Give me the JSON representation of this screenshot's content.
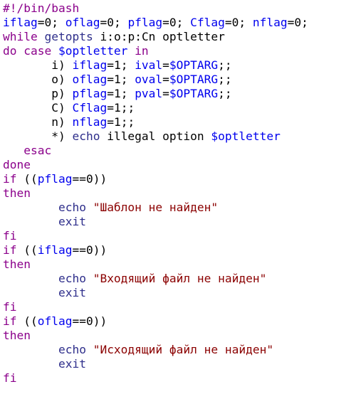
{
  "colors": {
    "default": "#000000",
    "keyword": "#8b008b",
    "variable": "#0000ee",
    "string": "#8b0000",
    "builtin": "#2e2e8b"
  },
  "lines": [
    [
      {
        "t": "#!/bin/bash",
        "c": "keyword"
      }
    ],
    [
      {
        "t": "iflag",
        "c": "variable"
      },
      {
        "t": "=0; ",
        "c": "default"
      },
      {
        "t": "oflag",
        "c": "variable"
      },
      {
        "t": "=0; ",
        "c": "default"
      },
      {
        "t": "pflag",
        "c": "variable"
      },
      {
        "t": "=0; ",
        "c": "default"
      },
      {
        "t": "Cflag",
        "c": "variable"
      },
      {
        "t": "=0; ",
        "c": "default"
      },
      {
        "t": "nflag",
        "c": "variable"
      },
      {
        "t": "=0;",
        "c": "default"
      }
    ],
    [
      {
        "t": "while ",
        "c": "keyword"
      },
      {
        "t": "getopts",
        "c": "builtin"
      },
      {
        "t": " i:o:p:Cn optletter",
        "c": "default"
      }
    ],
    [
      {
        "t": "do case ",
        "c": "keyword"
      },
      {
        "t": "$optletter",
        "c": "variable"
      },
      {
        "t": " in",
        "c": "keyword"
      }
    ],
    [
      {
        "t": "       i) ",
        "c": "default"
      },
      {
        "t": "iflag",
        "c": "variable"
      },
      {
        "t": "=1; ",
        "c": "default"
      },
      {
        "t": "ival",
        "c": "variable"
      },
      {
        "t": "=",
        "c": "default"
      },
      {
        "t": "$OPTARG",
        "c": "variable"
      },
      {
        "t": ";;",
        "c": "default"
      }
    ],
    [
      {
        "t": "       o) ",
        "c": "default"
      },
      {
        "t": "oflag",
        "c": "variable"
      },
      {
        "t": "=1; ",
        "c": "default"
      },
      {
        "t": "oval",
        "c": "variable"
      },
      {
        "t": "=",
        "c": "default"
      },
      {
        "t": "$OPTARG",
        "c": "variable"
      },
      {
        "t": ";;",
        "c": "default"
      }
    ],
    [
      {
        "t": "       p) ",
        "c": "default"
      },
      {
        "t": "pflag",
        "c": "variable"
      },
      {
        "t": "=1; ",
        "c": "default"
      },
      {
        "t": "pval",
        "c": "variable"
      },
      {
        "t": "=",
        "c": "default"
      },
      {
        "t": "$OPTARG",
        "c": "variable"
      },
      {
        "t": ";;",
        "c": "default"
      }
    ],
    [
      {
        "t": "       C) ",
        "c": "default"
      },
      {
        "t": "Cflag",
        "c": "variable"
      },
      {
        "t": "=1;;",
        "c": "default"
      }
    ],
    [
      {
        "t": "       n) ",
        "c": "default"
      },
      {
        "t": "nflag",
        "c": "variable"
      },
      {
        "t": "=1;;",
        "c": "default"
      }
    ],
    [
      {
        "t": "       *) ",
        "c": "default"
      },
      {
        "t": "echo",
        "c": "builtin"
      },
      {
        "t": " illegal option ",
        "c": "default"
      },
      {
        "t": "$optletter",
        "c": "variable"
      }
    ],
    [
      {
        "t": "   esac",
        "c": "keyword"
      }
    ],
    [
      {
        "t": "done",
        "c": "keyword"
      }
    ],
    [
      {
        "t": "if",
        "c": "keyword"
      },
      {
        "t": " ((",
        "c": "default"
      },
      {
        "t": "pflag",
        "c": "variable"
      },
      {
        "t": "==0))",
        "c": "default"
      }
    ],
    [
      {
        "t": "then",
        "c": "keyword"
      }
    ],
    [
      {
        "t": "        ",
        "c": "default"
      },
      {
        "t": "echo",
        "c": "builtin"
      },
      {
        "t": " \"Шаблон не найден\"",
        "c": "string"
      }
    ],
    [
      {
        "t": "        exit",
        "c": "builtin"
      }
    ],
    [
      {
        "t": "fi",
        "c": "keyword"
      }
    ],
    [
      {
        "t": "if",
        "c": "keyword"
      },
      {
        "t": " ((",
        "c": "default"
      },
      {
        "t": "iflag",
        "c": "variable"
      },
      {
        "t": "==0))",
        "c": "default"
      }
    ],
    [
      {
        "t": "then",
        "c": "keyword"
      }
    ],
    [
      {
        "t": "        ",
        "c": "default"
      },
      {
        "t": "echo",
        "c": "builtin"
      },
      {
        "t": " \"Входящий файл не найден\"",
        "c": "string"
      }
    ],
    [
      {
        "t": "        exit",
        "c": "builtin"
      }
    ],
    [
      {
        "t": "fi",
        "c": "keyword"
      }
    ],
    [
      {
        "t": "if",
        "c": "keyword"
      },
      {
        "t": " ((",
        "c": "default"
      },
      {
        "t": "oflag",
        "c": "variable"
      },
      {
        "t": "==0))",
        "c": "default"
      }
    ],
    [
      {
        "t": "then",
        "c": "keyword"
      }
    ],
    [
      {
        "t": "        ",
        "c": "default"
      },
      {
        "t": "echo",
        "c": "builtin"
      },
      {
        "t": " \"Исходящий файл не найден\"",
        "c": "string"
      }
    ],
    [
      {
        "t": "        exit",
        "c": "builtin"
      }
    ],
    [
      {
        "t": "fi",
        "c": "keyword"
      }
    ]
  ]
}
